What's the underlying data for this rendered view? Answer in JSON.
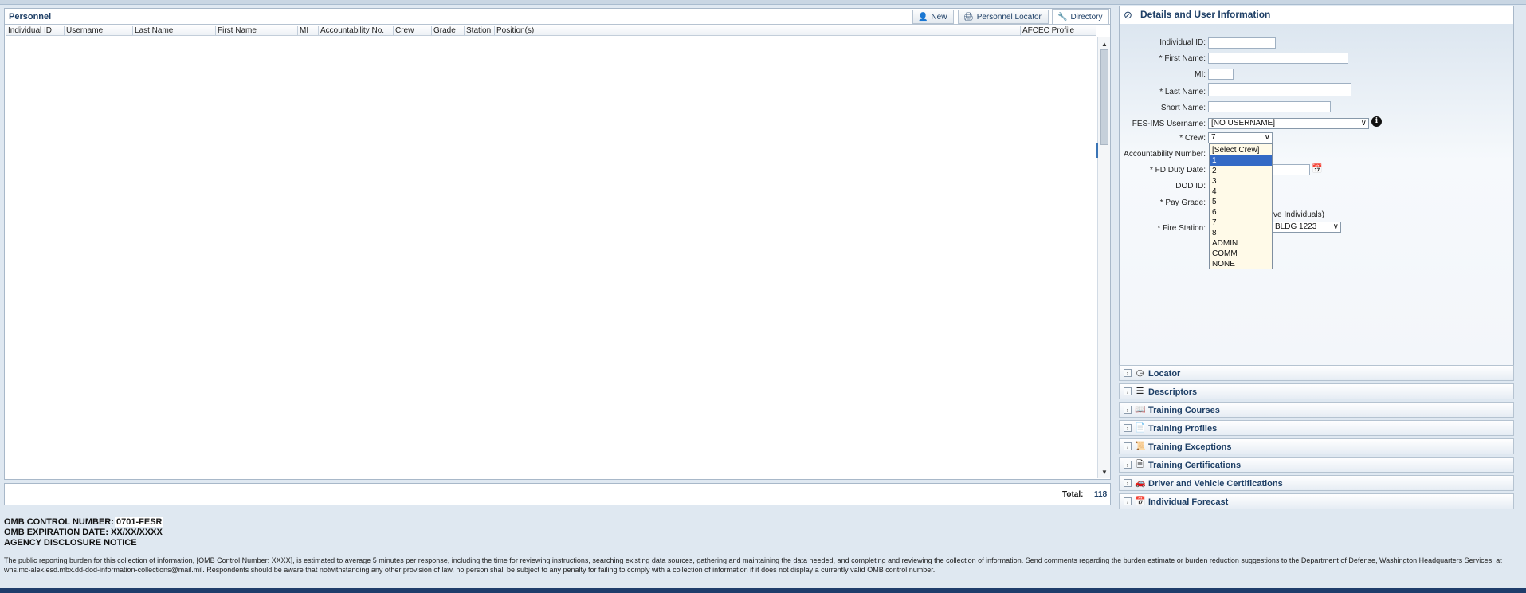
{
  "personnel": {
    "title": "Personnel",
    "buttons": {
      "new": "New",
      "locator": "Personnel Locator",
      "directory": "Directory"
    },
    "columns": [
      "Individual ID",
      "Username",
      "Last Name",
      "First Name",
      "MI",
      "Accountability No.",
      "Crew",
      "Grade",
      "Station",
      "Position(s)",
      "AFCEC Profile"
    ],
    "total_label": "Total:",
    "total_value": "118"
  },
  "omb": {
    "control_label": "OMB CONTROL NUMBER:",
    "control_value": "0701-FESR",
    "expiration": "OMB EXPIRATION DATE: XX/XX/XXXX",
    "disclosure": "AGENCY DISCLOSURE NOTICE",
    "notice": "The public reporting burden for this collection of information, [OMB Control Number: XXXX], is estimated to average 5 minutes per response, including the time for reviewing instructions, searching existing data sources, gathering and maintaining the data needed, and completing and reviewing the collection of information. Send comments regarding the burden estimate or burden reduction suggestions to the Department of Defense, Washington Headquarters Services, at whs.mc-alex.esd.mbx.dd-dod-information-collections@mail.mil. Respondents should be aware that notwithstanding any other provision of law, no person shall be subject to any penalty for failing to comply with a collection of information if it does not display a currently valid OMB control number."
  },
  "details": {
    "title": "Details and User Information",
    "labels": {
      "individual_id": "Individual ID:",
      "first_name": "* First Name:",
      "mi": "MI:",
      "last_name": "* Last Name:",
      "short_name": "Short Name:",
      "username": "FES-IMS Username:",
      "crew": "* Crew:",
      "accountability": "Accountability Number:",
      "fd_duty_date": "* FD Duty Date:",
      "dod_id": "DOD ID:",
      "pay_grade": "* Pay Grade:",
      "fire_station": "* Fire Station:"
    },
    "username_value": "[NO USERNAME]",
    "crew_value": "7",
    "partial_inactive": "ve Individuals)",
    "fire_station_partial": "BLDG 1223"
  },
  "crew_dropdown": [
    "[Select Crew]",
    "1",
    "2",
    "3",
    "4",
    "5",
    "6",
    "7",
    "8",
    "ADMIN",
    "COMM",
    "NONE"
  ],
  "accordion": [
    "Locator",
    "Descriptors",
    "Training Courses",
    "Training Profiles",
    "Training Exceptions",
    "Training Certifications",
    "Driver and Vehicle Certifications",
    "Individual Forecast"
  ]
}
